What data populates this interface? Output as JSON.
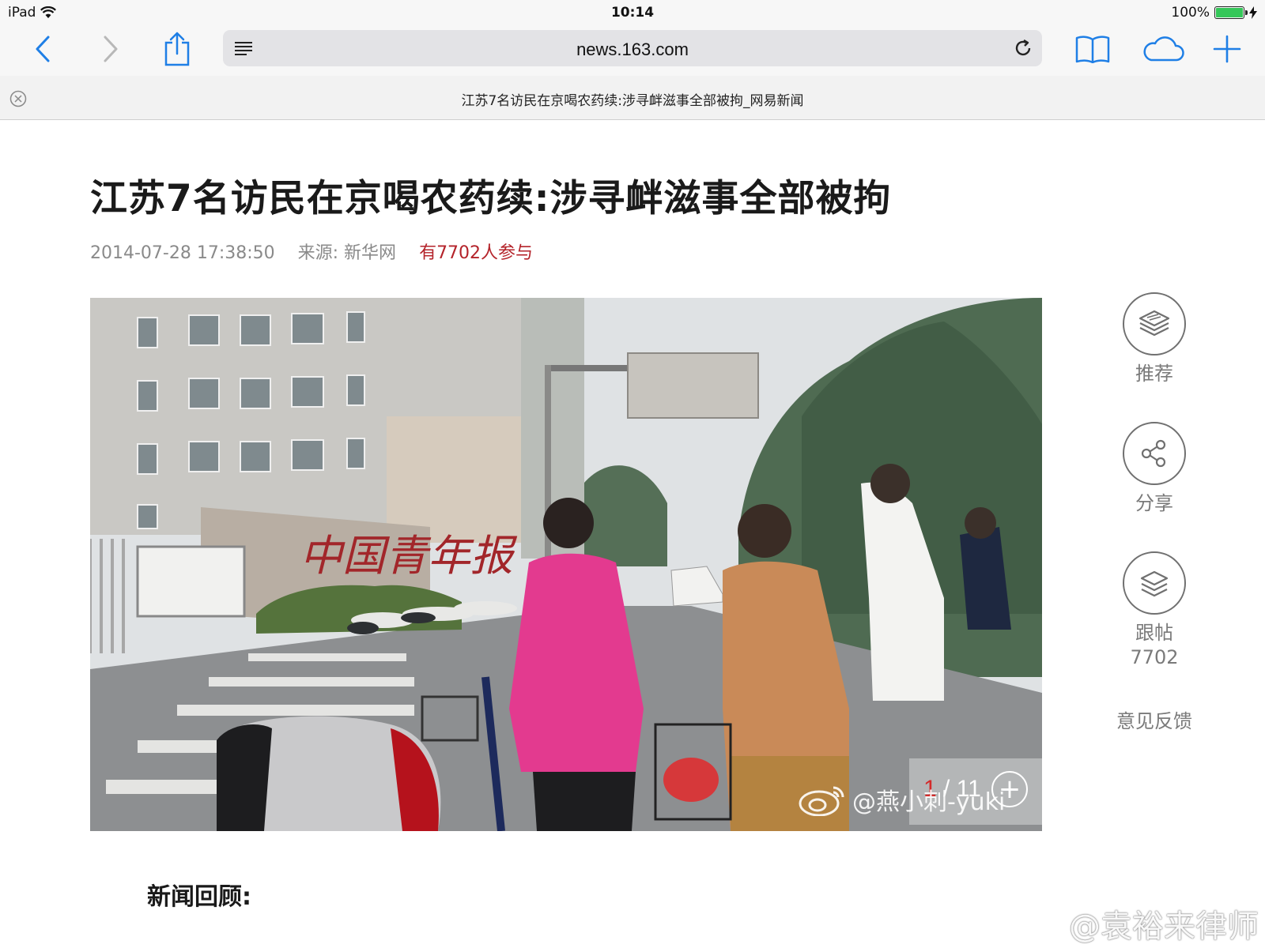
{
  "status_bar": {
    "device": "iPad",
    "time": "10:14",
    "battery": "100%",
    "battery_level": 1.0
  },
  "toolbar": {
    "url": "news.163.com",
    "icons": [
      "back-icon",
      "forward-icon",
      "share-icon",
      "reader-icon",
      "reload-icon",
      "bookmarks-icon",
      "cloud-tabs-icon",
      "new-tab-icon"
    ]
  },
  "tab": {
    "title": "江苏7名访民在京喝农药续:涉寻衅滋事全部被拘_网易新闻"
  },
  "article": {
    "headline": "江苏7名访民在京喝农药续:涉寻衅滋事全部被拘",
    "datetime": "2014-07-28 17:38:50",
    "source": "来源: 新华网",
    "participants": "有7702人参与",
    "gallery": {
      "current": "1",
      "separator": " / ",
      "total": "11",
      "weibo_watermark": "@燕小刺-yuki",
      "wall_sign": "中国青年报"
    },
    "section_heading": "新闻回顾:"
  },
  "side_rail": {
    "recommend": "推荐",
    "share": "分享",
    "comment_label": "跟帖",
    "comment_count": "7702",
    "feedback": "意见反馈"
  },
  "corner_watermark": "@袁裕来律师",
  "colors": {
    "accent_red": "#b4232a",
    "ios_blue": "#1f7fe6",
    "battery_green": "#35c759"
  }
}
